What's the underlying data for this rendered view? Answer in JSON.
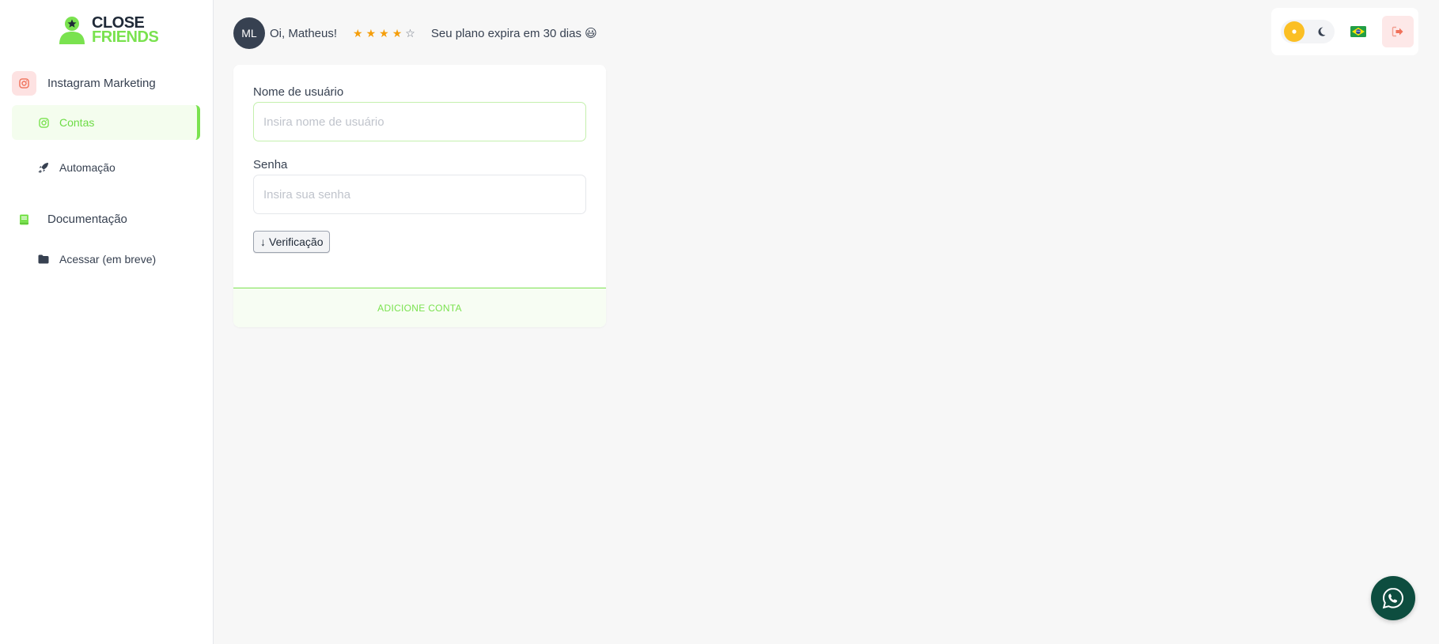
{
  "brand": {
    "line1": "CLOSE",
    "line2": "FRIENDS",
    "accent": "#7ae24f"
  },
  "sidebar": {
    "sections": [
      {
        "label": "Instagram Marketing",
        "icon": "instagram-icon",
        "items": [
          {
            "label": "Contas",
            "icon": "instagram-icon",
            "active": true
          },
          {
            "label": "Automação",
            "icon": "rocket-icon",
            "active": false
          }
        ]
      },
      {
        "label": "Documentação",
        "icon": "book-icon",
        "items": [
          {
            "label": "Acessar (em breve)",
            "icon": "folder-icon",
            "active": false
          }
        ]
      }
    ]
  },
  "header": {
    "avatar_initials": "ML",
    "greeting": "Oi, Matheus!",
    "rating": {
      "value": 4,
      "max": 5
    },
    "plan_text": "Seu plano expira em 30 dias 😃"
  },
  "controls": {
    "theme": "light",
    "language_flag": "🇧🇷"
  },
  "form": {
    "username_label": "Nome de usuário",
    "username_placeholder": "Insira nome de usuário",
    "username_value": "",
    "password_label": "Senha",
    "password_placeholder": "Insira sua senha",
    "password_value": "",
    "verify_label": "Verificação",
    "submit_label": "ADICIONE CONTA"
  }
}
